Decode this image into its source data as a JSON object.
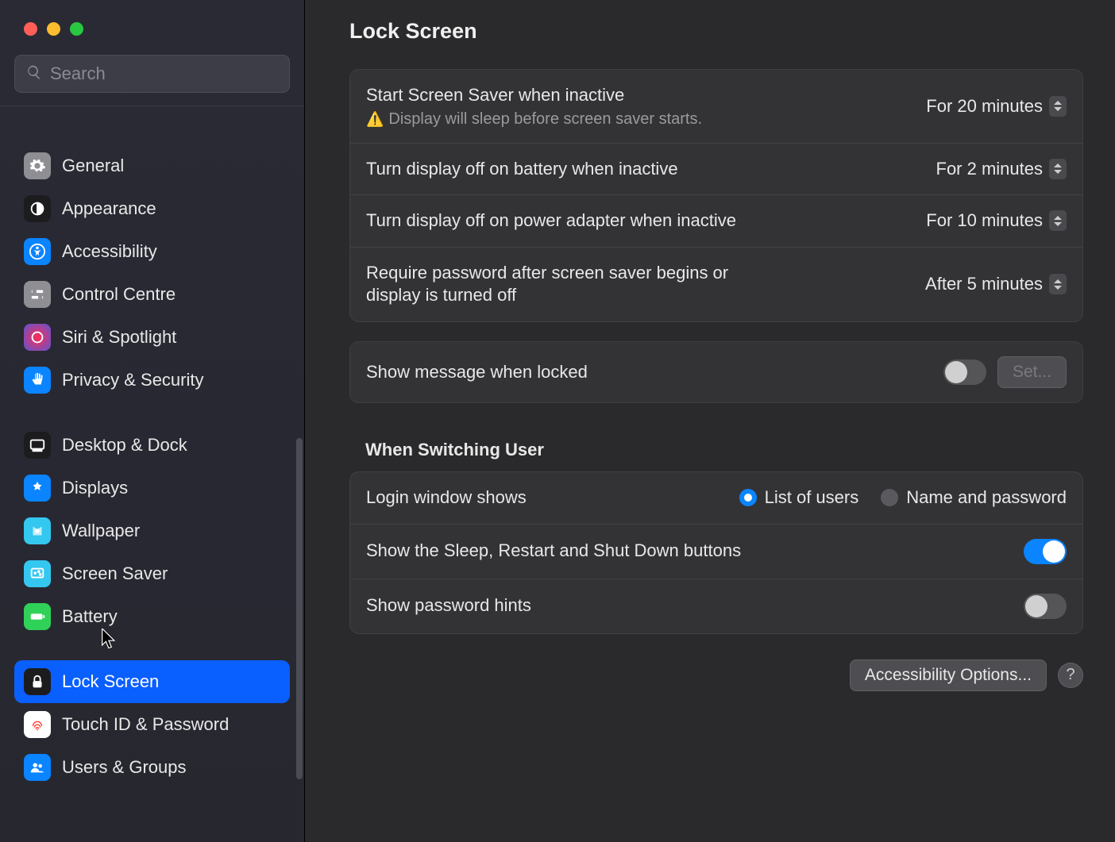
{
  "search": {
    "placeholder": "Search"
  },
  "sidebar": {
    "group1": [
      {
        "label": "General",
        "icon": "gear",
        "bg": "#8e8e93"
      },
      {
        "label": "Appearance",
        "icon": "appearance",
        "bg": "#1c1c1e"
      },
      {
        "label": "Accessibility",
        "icon": "accessibility",
        "bg": "#0a84ff"
      },
      {
        "label": "Control Centre",
        "icon": "control",
        "bg": "#8e8e93"
      },
      {
        "label": "Siri & Spotlight",
        "icon": "siri",
        "bg": "#1c1c1e"
      },
      {
        "label": "Privacy & Security",
        "icon": "hand",
        "bg": "#0a84ff"
      }
    ],
    "group2": [
      {
        "label": "Desktop & Dock",
        "icon": "dock",
        "bg": "#1c1c1e"
      },
      {
        "label": "Displays",
        "icon": "displays",
        "bg": "#0a84ff"
      },
      {
        "label": "Wallpaper",
        "icon": "wallpaper",
        "bg": "#34c7f0"
      },
      {
        "label": "Screen Saver",
        "icon": "screensaver",
        "bg": "#34c7f0"
      },
      {
        "label": "Battery",
        "icon": "battery",
        "bg": "#30d158"
      }
    ],
    "group3": [
      {
        "label": "Lock Screen",
        "icon": "lock",
        "bg": "#1c1c1e",
        "selected": true
      },
      {
        "label": "Touch ID & Password",
        "icon": "touchid",
        "bg": "#fff"
      },
      {
        "label": "Users & Groups",
        "icon": "users",
        "bg": "#0a84ff"
      }
    ]
  },
  "main": {
    "title": "Lock Screen",
    "rows": {
      "screensaver": {
        "label": "Start Screen Saver when inactive",
        "value": "For 20 minutes",
        "warning": "Display will sleep before screen saver starts."
      },
      "battery_off": {
        "label": "Turn display off on battery when inactive",
        "value": "For 2 minutes"
      },
      "adapter_off": {
        "label": "Turn display off on power adapter when inactive",
        "value": "For 10 minutes"
      },
      "require_pw": {
        "label": "Require password after screen saver begins or display is turned off",
        "value": "After 5 minutes"
      },
      "show_msg": {
        "label": "Show message when locked",
        "button": "Set..."
      }
    },
    "switching": {
      "heading": "When Switching User",
      "login_shows": {
        "label": "Login window shows",
        "opt1": "List of users",
        "opt2": "Name and password"
      },
      "sleep_buttons": {
        "label": "Show the Sleep, Restart and Shut Down buttons"
      },
      "pw_hints": {
        "label": "Show password hints"
      }
    },
    "footer": {
      "accessibility_options": "Accessibility Options...",
      "help": "?"
    }
  }
}
